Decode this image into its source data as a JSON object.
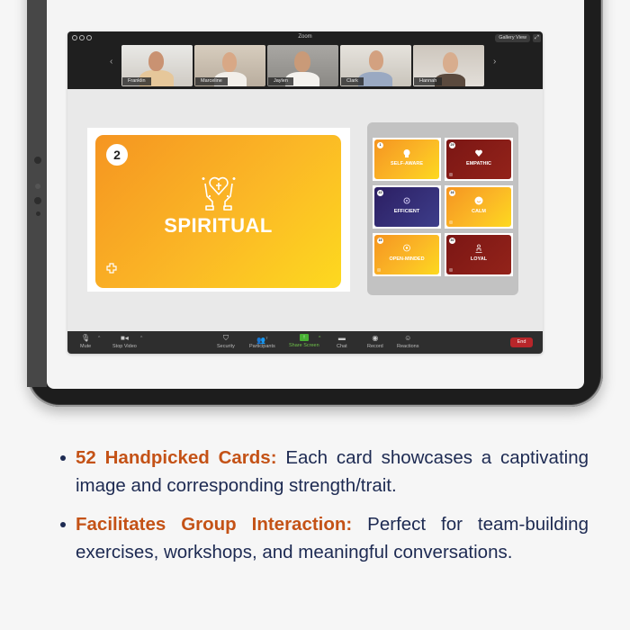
{
  "window": {
    "title": "Zoom",
    "gallery_view_label": "Gallery View"
  },
  "participants": [
    {
      "name": "Franklin"
    },
    {
      "name": "Marceline"
    },
    {
      "name": "Jaylen"
    },
    {
      "name": "Clark"
    },
    {
      "name": "Hannah"
    }
  ],
  "shared_card": {
    "number": "2",
    "title": "SPIRITUAL",
    "icon": "heart-cross-hands-icon"
  },
  "card_grid": [
    {
      "number": "1",
      "label": "SELF-AWARE",
      "color": "orange",
      "icon": "brain-head-icon"
    },
    {
      "number": "29",
      "label": "EMPATHIC",
      "color": "red",
      "icon": "heart-icon"
    },
    {
      "number": "43",
      "label": "EFFICIENT",
      "color": "purple",
      "icon": "gears-icon"
    },
    {
      "number": "16",
      "label": "CALM",
      "color": "orange",
      "icon": "smile-icon"
    },
    {
      "number": "15",
      "label": "OPEN-MINDED",
      "color": "orange",
      "icon": "open-mind-icon"
    },
    {
      "number": "30",
      "label": "LOYAL",
      "color": "red",
      "icon": "people-icon"
    }
  ],
  "toolbar": {
    "mute": "Mute",
    "stop_video": "Stop Video",
    "security": "Security",
    "participants": "Participants",
    "participants_count": "7",
    "share_screen": "Share Screen",
    "chat": "Chat",
    "record": "Record",
    "reactions": "Reactions",
    "end": "End"
  },
  "bullets": [
    {
      "highlight": "52 Handpicked Cards:",
      "text": " Each card showcases a captivating image and corresponding strength/trait."
    },
    {
      "highlight": "Facilitates Group Interaction:",
      "text": " Perfect for team-building exercises, workshops, and meaningful conversations."
    }
  ],
  "colors": {
    "accent_text": "#c45216",
    "body_text": "#1d2a52",
    "card_orange": "#f8a423",
    "card_red": "#8a1e18",
    "card_purple": "#33286f",
    "end_button": "#b8262a",
    "share_green": "#47b033"
  }
}
